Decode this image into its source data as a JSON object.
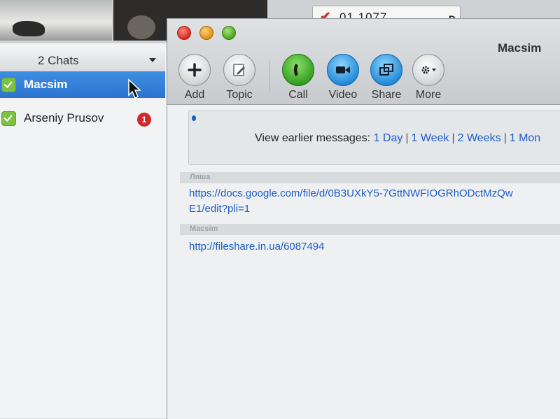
{
  "background": {
    "status_field": {
      "value": "01  1077",
      "cap": "D"
    }
  },
  "chats": {
    "header_label": "2 Chats",
    "items": [
      {
        "name": "Macsim",
        "selected": true
      },
      {
        "name": "Arseniy Prusov",
        "badge": "1"
      }
    ]
  },
  "window": {
    "title": "Macsim",
    "toolbar": [
      {
        "label": "Add",
        "icon": "plus-icon"
      },
      {
        "label": "Topic",
        "icon": "pencil-icon"
      },
      {
        "label": "Call",
        "icon": "phone-icon"
      },
      {
        "label": "Video",
        "icon": "video-camera-icon"
      },
      {
        "label": "Share",
        "icon": "share-screen-icon"
      },
      {
        "label": "More",
        "icon": "gear-icon"
      }
    ]
  },
  "messages": {
    "earlier": {
      "prefix": "View earlier messages:",
      "links": [
        "1 Day",
        "1 Week",
        "2 Weeks",
        "1 Mon"
      ]
    },
    "items": [
      {
        "sender": "Ляша",
        "lines": [
          "https://docs.google.com/file/d/0B3UXkY5-7GttNWFIOGRhODctMzQw",
          "E1/edit?pli=1"
        ]
      },
      {
        "sender": "Macsim",
        "lines": [
          "http://fileshare.in.ua/6087494"
        ]
      }
    ]
  },
  "colors": {
    "selection": "#2f7bd6",
    "link": "#1e5dc8",
    "call_green": "#2f9a1e",
    "action_blue": "#1b86d6",
    "badge_red": "#d0282c"
  }
}
